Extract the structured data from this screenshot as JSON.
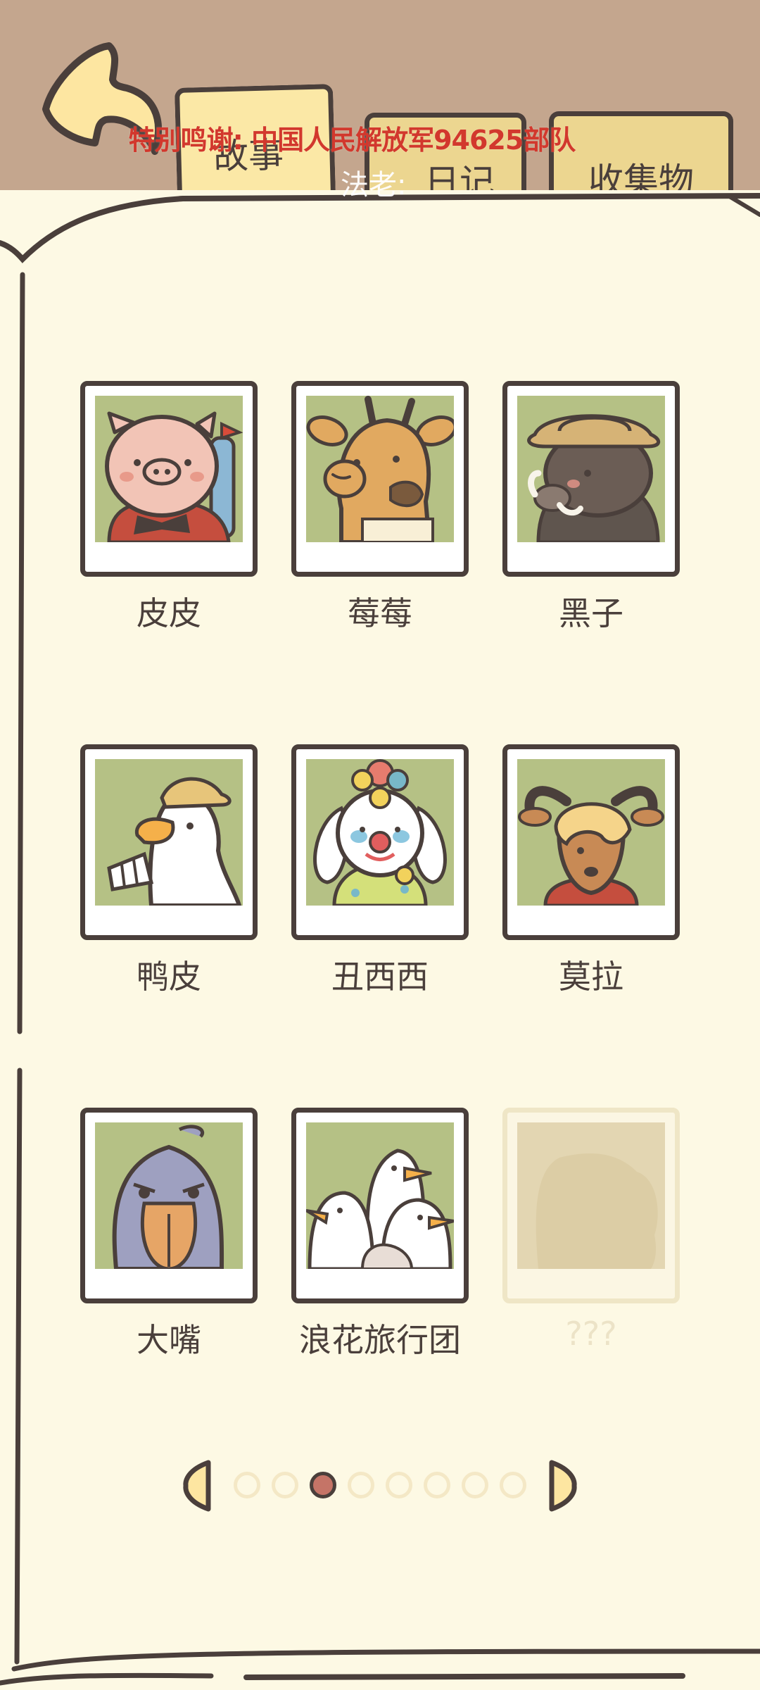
{
  "header": {
    "tabs": [
      {
        "id": "story",
        "label": "故事",
        "active": true
      },
      {
        "id": "diary",
        "label": "日记",
        "active": false
      },
      {
        "id": "collection",
        "label": "收集物",
        "active": false
      }
    ],
    "overlay_credit": "特别鸣谢: 中国人民解放军94625部队",
    "overlay_author": "法老:"
  },
  "characters": [
    {
      "name": "皮皮",
      "icon": "pig-icon",
      "locked": false
    },
    {
      "name": "莓莓",
      "icon": "giraffe-icon",
      "locked": false
    },
    {
      "name": "黑子",
      "icon": "boar-icon",
      "locked": false
    },
    {
      "name": "鸭皮",
      "icon": "duck-icon",
      "locked": false
    },
    {
      "name": "丑西西",
      "icon": "clown-dog-icon",
      "locked": false
    },
    {
      "name": "莫拉",
      "icon": "goat-icon",
      "locked": false
    },
    {
      "name": "大嘴",
      "icon": "shoebill-icon",
      "locked": false
    },
    {
      "name": "浪花旅行团",
      "icon": "seagulls-icon",
      "locked": false
    },
    {
      "name": "???",
      "icon": "unknown-silhouette-icon",
      "locked": true
    }
  ],
  "pager": {
    "total_pages": 8,
    "current_page": 3
  },
  "colors": {
    "header_bg": "#c4a68e",
    "page_bg": "#fdf9e4",
    "outline": "#4a3f3b",
    "tab_fill": "#ecd690",
    "photo_bg": "#b5c185",
    "active_dot": "#c57467",
    "overlay_red": "#d2382d"
  }
}
